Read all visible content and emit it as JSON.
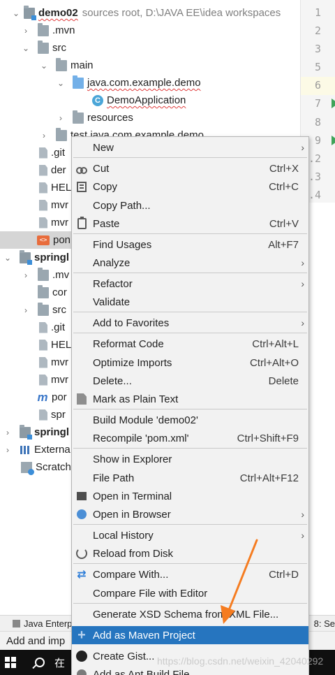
{
  "tree": {
    "root_name": "demo02",
    "root_path": "sources root,  D:\\JAVA EE\\idea workspaces",
    "mvn": ".mvn",
    "src": "src",
    "main": "main",
    "pkg": "java.com.example.demo",
    "app_class": "DemoApplication",
    "resources": "resources",
    "test": "test java.com.example.demo",
    "gitignore_1": ".git",
    "file_demo": "der",
    "help_1": "HEL",
    "mvnw_1": "mvr",
    "mvnw_cmd_1": "mvr",
    "pom_1": "pon",
    "project2": "springl",
    "mvn_2": ".mv",
    "com_2": "cor",
    "src_2": "src",
    "gitignore_2": ".git",
    "help_2": "HEL",
    "mvnw_2": "mvr",
    "mvnw_cmd_2": "mvr",
    "pom_2": "por",
    "spr_2": "spr",
    "project3": "springl",
    "external": "Externa",
    "scratches": "Scratch"
  },
  "gutter": {
    "lines": [
      "1",
      "2",
      "3",
      "5",
      "6",
      "7",
      "8",
      "9",
      ".2",
      ".3",
      ".4"
    ]
  },
  "menu": {
    "new": "New",
    "cut": "Cut",
    "cut_sc": "Ctrl+X",
    "copy": "Copy",
    "copy_sc": "Ctrl+C",
    "copy_path": "Copy Path...",
    "paste": "Paste",
    "paste_sc": "Ctrl+V",
    "find_usages": "Find Usages",
    "find_usages_sc": "Alt+F7",
    "analyze": "Analyze",
    "refactor": "Refactor",
    "validate": "Validate",
    "add_fav": "Add to Favorites",
    "reformat": "Reformat Code",
    "reformat_sc": "Ctrl+Alt+L",
    "optimize": "Optimize Imports",
    "optimize_sc": "Ctrl+Alt+O",
    "delete": "Delete...",
    "delete_sc": "Delete",
    "mark_plain": "Mark as Plain Text",
    "build_module": "Build Module 'demo02'",
    "recompile": "Recompile 'pom.xml'",
    "recompile_sc": "Ctrl+Shift+F9",
    "show_explorer": "Show in Explorer",
    "file_path": "File Path",
    "file_path_sc": "Ctrl+Alt+F12",
    "open_terminal": "Open in Terminal",
    "open_browser": "Open in Browser",
    "local_history": "Local History",
    "reload_disk": "Reload from Disk",
    "compare_with": "Compare With...",
    "compare_with_sc": "Ctrl+D",
    "compare_editor": "Compare File with Editor",
    "gen_xsd": "Generate XSD Schema from XML File...",
    "add_maven": "Add as Maven Project",
    "create_gist": "Create Gist...",
    "add_ant": "Add as Ant Build File"
  },
  "bottom": {
    "tool_java": "Java Enterp",
    "tool_right": "8: Se",
    "status": "Add and imp",
    "taskbar_search": "在"
  },
  "watermark": "https://blog.csdn.net/weixin_42040292",
  "colors": {
    "menu_bg": "#f2f2f2",
    "selection": "#2675bf",
    "annotation_arrow": "#f57c20"
  }
}
